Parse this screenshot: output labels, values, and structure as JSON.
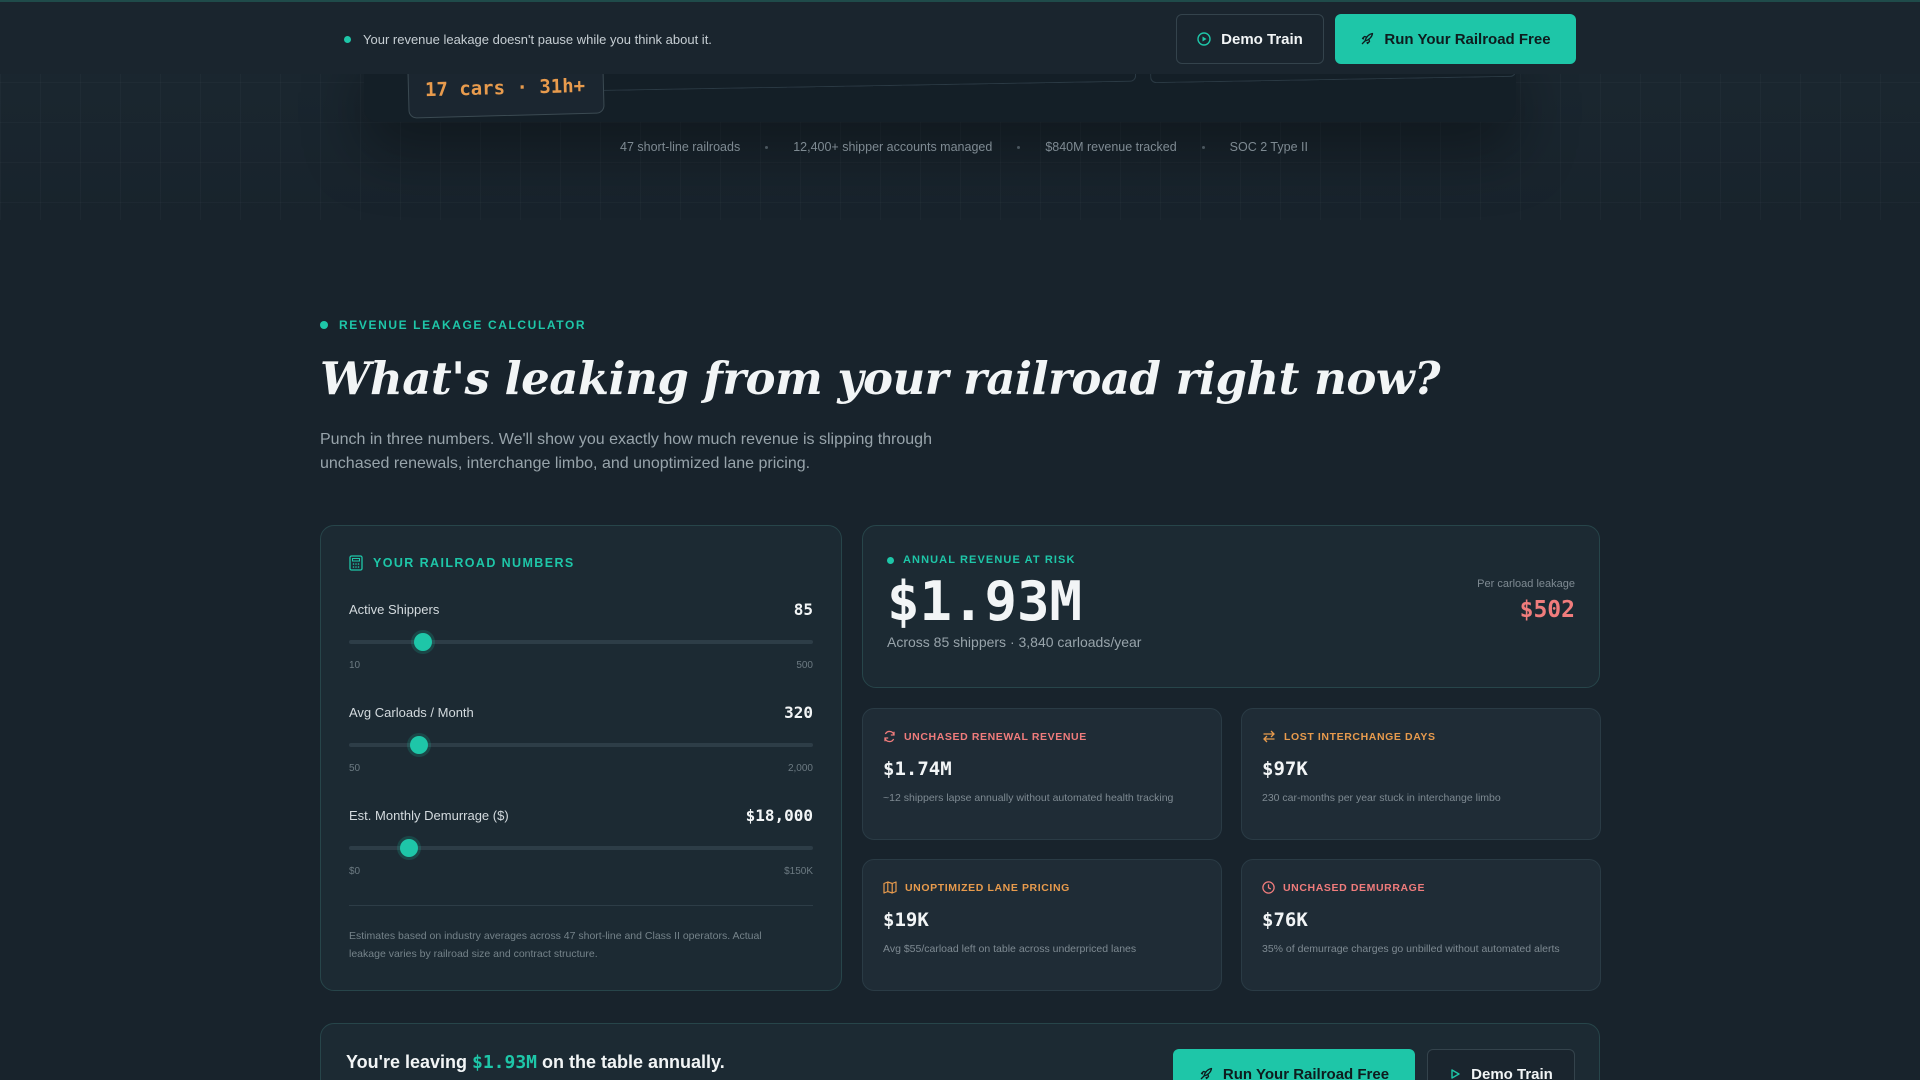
{
  "banner": {
    "message": "Your revenue leakage doesn't pause while you think about it.",
    "demo_button": "Demo Train",
    "run_button": "Run Your Railroad Free"
  },
  "hero": {
    "cars_badge": "17 cars · 31h+",
    "trust_items": [
      "47 short-line railroads",
      "12,400+ shipper accounts managed",
      "$840M revenue tracked",
      "SOC 2 Type II"
    ]
  },
  "calculator": {
    "eyebrow": "REVENUE LEAKAGE CALCULATOR",
    "headline": "What's leaking from your railroad right now?",
    "subhead": "Punch in three numbers. We'll show you exactly how much revenue is slipping through unchased renewals, interchange limbo, and unoptimized lane pricing.",
    "inputs": {
      "title": "YOUR RAILROAD NUMBERS",
      "sliders": [
        {
          "label": "Active Shippers",
          "value": "85",
          "min": "10",
          "max": "500",
          "fraction": 0.16
        },
        {
          "label": "Avg Carloads / Month",
          "value": "320",
          "min": "50",
          "max": "2,000",
          "fraction": 0.15
        },
        {
          "label": "Est. Monthly Demurrage ($)",
          "value": "$18,000",
          "min": "$0",
          "max": "$150K",
          "fraction": 0.13
        }
      ],
      "disclaimer": "Estimates based on industry averages across 47 short-line and Class II operators. Actual leakage varies by railroad size and contract structure."
    },
    "total": {
      "label": "ANNUAL REVENUE AT RISK",
      "value": "$1.93M",
      "sub": "Across 85 shippers · 3,840 carloads/year",
      "per_label": "Per carload leakage",
      "per_value": "$502"
    },
    "cards": [
      {
        "icon": "refresh-icon",
        "label": "UNCHASED RENEWAL REVENUE",
        "value": "$1.74M",
        "desc": "~12 shippers lapse annually without automated health tracking",
        "color": "#f07c7c"
      },
      {
        "icon": "swap-arrows-icon",
        "label": "LOST INTERCHANGE DAYS",
        "value": "$97K",
        "desc": "230 car-months per year stuck in interchange limbo",
        "color": "#e89b4d"
      },
      {
        "icon": "map-icon",
        "label": "UNOPTIMIZED LANE PRICING",
        "value": "$19K",
        "desc": "Avg $55/carload left on table across underpriced lanes",
        "color": "#e89b4d"
      },
      {
        "icon": "clock-icon",
        "label": "UNCHASED DEMURRAGE",
        "value": "$76K",
        "desc": "35% of demurrage charges go unbilled without automated alerts",
        "color": "#f07c7c"
      }
    ],
    "cta": {
      "prefix": "You're leaving",
      "amount": "$1.93M",
      "suffix": "on the table annually.",
      "run_button": "Run Your Railroad Free",
      "demo_button": "Demo Train"
    }
  },
  "colors": {
    "accent": "#1ec6a8",
    "danger": "#f07c7c",
    "warning": "#e89b4d"
  }
}
